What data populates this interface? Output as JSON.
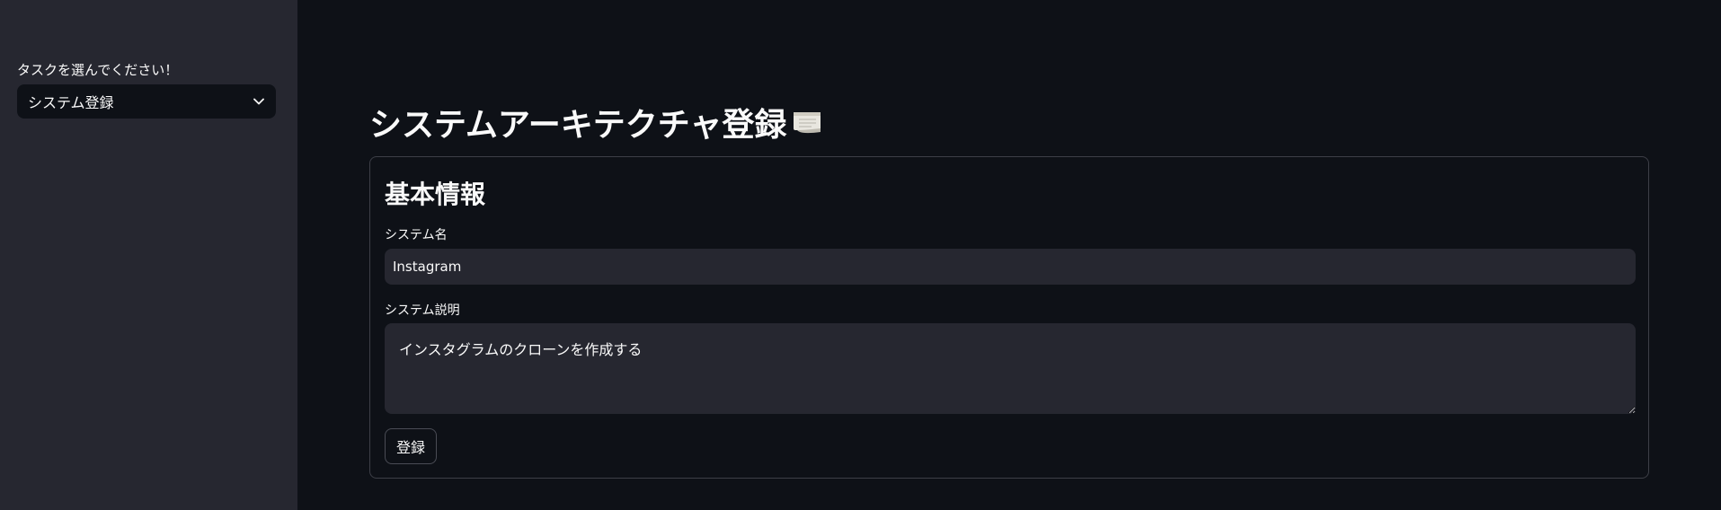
{
  "sidebar": {
    "task_label": "タスクを選んでください！",
    "task_select_value": "システム登録",
    "select_icon": "chevron-down-icon"
  },
  "main": {
    "title": "システムアーキテクチャ登録",
    "title_icon": "scroll-icon",
    "form": {
      "section_title": "基本情報",
      "system_name_label": "システム名",
      "system_name_value": "Instagram",
      "system_desc_label": "システム説明",
      "system_desc_value": "インスタグラムのクローンを作成する",
      "submit_label": "登録"
    }
  },
  "colors": {
    "background": "#0e1117",
    "sidebar": "#262730",
    "input": "#262730",
    "text": "#fafafa",
    "border": "#3d3f47"
  }
}
